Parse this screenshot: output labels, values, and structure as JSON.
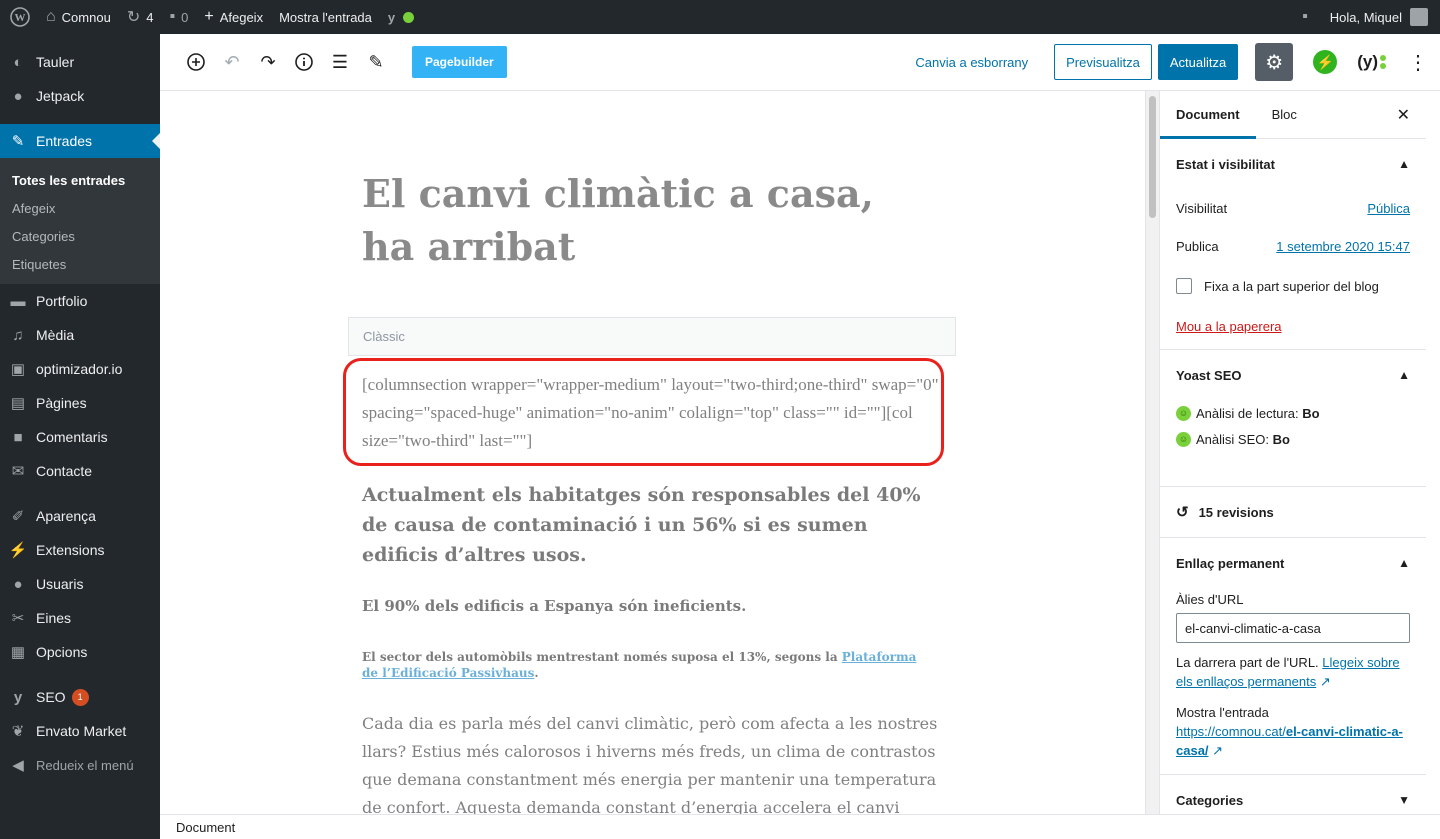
{
  "adminbar": {
    "site_name": "Comnou",
    "updates": "4",
    "comments": "0",
    "add_new": "Afegeix",
    "view_post": "Mostra l'entrada",
    "greeting": "Hola, Miquel"
  },
  "sidebar": {
    "items": [
      {
        "label": "Tauler",
        "icon": "dashboard-icon"
      },
      {
        "label": "Jetpack",
        "icon": "jetpack-icon"
      },
      {
        "label": "Entrades",
        "icon": "pin-icon",
        "active": true
      },
      {
        "label": "Portfolio",
        "icon": "folder-icon"
      },
      {
        "label": "Mèdia",
        "icon": "media-icon"
      },
      {
        "label": "optimizador.io",
        "icon": "optimizer-icon"
      },
      {
        "label": "Pàgines",
        "icon": "pages-icon"
      },
      {
        "label": "Comentaris",
        "icon": "comment-icon"
      },
      {
        "label": "Contacte",
        "icon": "mail-icon"
      },
      {
        "label": "Aparença",
        "icon": "brush-icon"
      },
      {
        "label": "Extensions",
        "icon": "plugin-icon"
      },
      {
        "label": "Usuaris",
        "icon": "user-icon"
      },
      {
        "label": "Eines",
        "icon": "wrench-icon"
      },
      {
        "label": "Opcions",
        "icon": "settings-icon"
      },
      {
        "label": "SEO",
        "icon": "yoast-icon",
        "badge": "1"
      },
      {
        "label": "Envato Market",
        "icon": "envato-icon"
      },
      {
        "label": "Redueix el menú",
        "icon": "collapse-icon"
      }
    ],
    "submenu": [
      "Totes les entrades",
      "Afegeix",
      "Categories",
      "Etiquetes"
    ]
  },
  "toolbar": {
    "pagebuilder": "Pagebuilder",
    "draft": "Canvia a esborrany",
    "preview": "Previsualitza",
    "update": "Actualitza"
  },
  "editor": {
    "title": "El canvi climàtic a casa, ha arribat",
    "classic_label": "Clàssic",
    "shortcode": "[columnsection wrapper=\"wrapper-medium\" layout=\"two-third;one-third\" swap=\"0\" spacing=\"spaced-huge\" animation=\"no-anim\" colalign=\"top\" class=\"\" id=\"\"][col size=\"two-third\" last=\"\"]",
    "heading": "Actualment els habitatges són responsables del 40% de causa de contaminació i un 56% si es sumen edificis d’altres usos.",
    "subheading": "El 90% dels edificis a Espanya són ineficients.",
    "small_text": "El sector dels automòbils mentrestant només suposa el 13%, segons la",
    "small_link": "Plataforma de l’Edificació Passivhaus",
    "small_end": ".",
    "paragraph": "Cada dia es parla més del canvi climàtic, però com afecta a les nostres llars? Estius més calorosos i hiverns més freds, un clima de contrastos que demana constantment més energia per mantenir una temperatura de confort. Aquesta demanda constant d’energia accelera el canvi climàtic."
  },
  "settings": {
    "tab_document": "Document",
    "tab_block": "Bloc",
    "status_title": "Estat i visibilitat",
    "visibility_label": "Visibilitat",
    "visibility_value": "Pública",
    "publish_label": "Publica",
    "publish_value": "1 setembre 2020 15:47",
    "sticky_label": "Fixa a la part superior del blog",
    "trash": "Mou a la paperera",
    "yoast_title": "Yoast SEO",
    "readability_label": "Anàlisi de lectura:",
    "readability_value": "Bo",
    "seo_label": "Anàlisi SEO:",
    "seo_value": "Bo",
    "revisions": "15 revisions",
    "permalink_title": "Enllaç permanent",
    "slug_label": "Àlies d'URL",
    "slug_value": "el-canvi-climatic-a-casa",
    "help_text": "La darrera part de l'URL.",
    "help_link": "Llegeix sobre els enllaços permanents",
    "view_label": "Mostra l'entrada",
    "url_base": "https://comnou.cat/",
    "url_slug": "el-canvi-climatic-a-casa/",
    "categories_title": "Categories"
  },
  "footer": {
    "breadcrumb": "Document"
  }
}
